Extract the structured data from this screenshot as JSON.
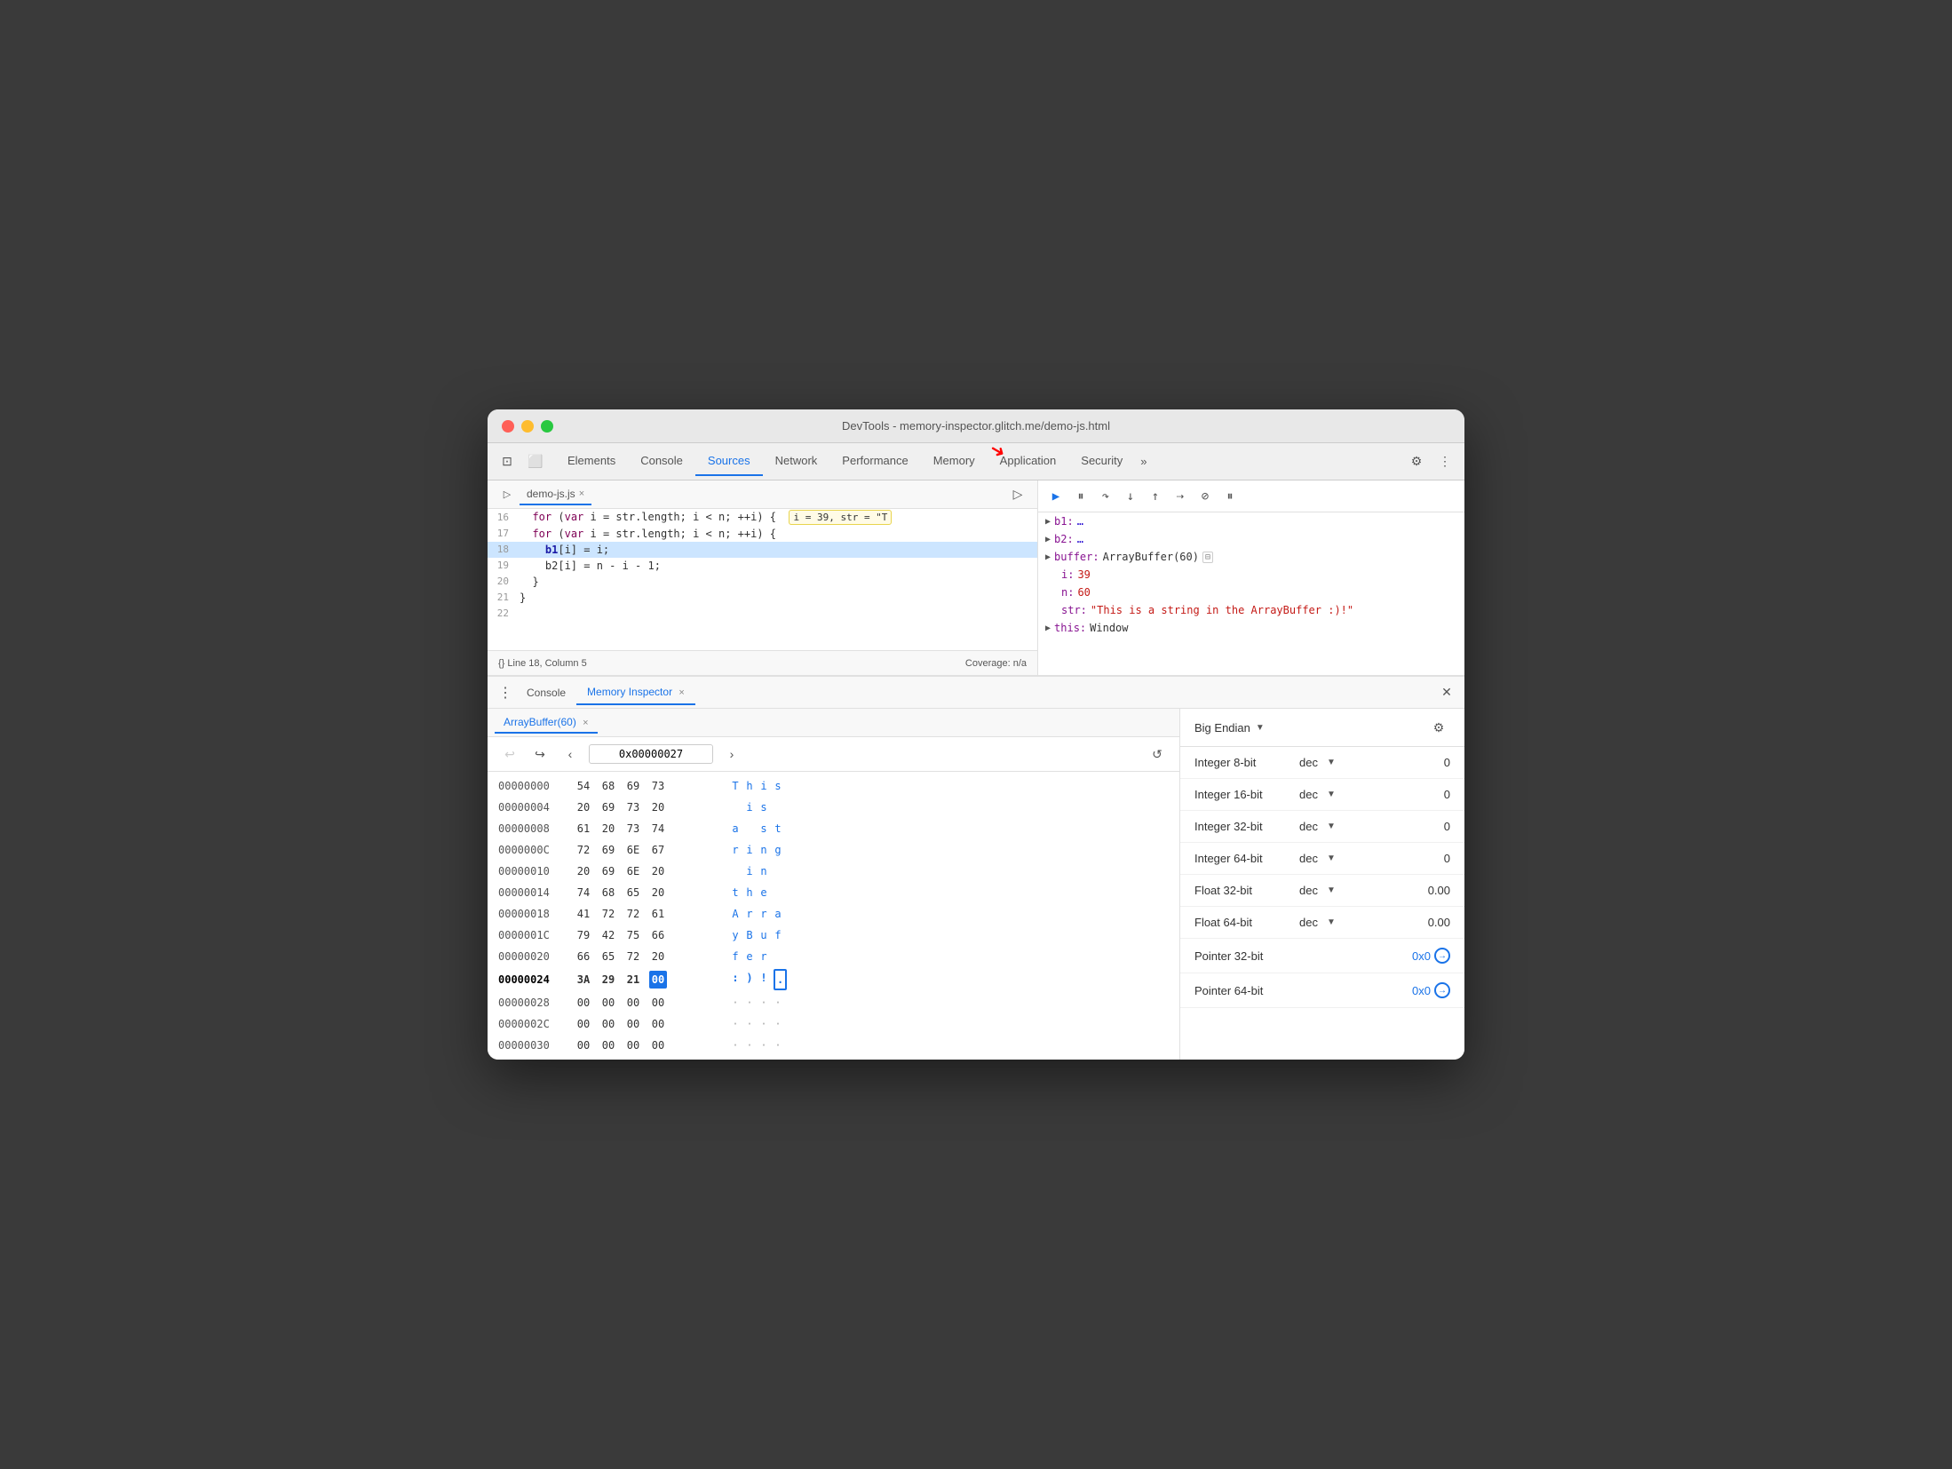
{
  "window": {
    "title": "DevTools - memory-inspector.glitch.me/demo-js.html"
  },
  "traffic_lights": {
    "red": "close",
    "yellow": "minimize",
    "green": "maximize"
  },
  "devtools_tabs": {
    "items": [
      {
        "id": "elements",
        "label": "Elements",
        "active": false
      },
      {
        "id": "console",
        "label": "Console",
        "active": false
      },
      {
        "id": "sources",
        "label": "Sources",
        "active": true
      },
      {
        "id": "network",
        "label": "Network",
        "active": false
      },
      {
        "id": "performance",
        "label": "Performance",
        "active": false
      },
      {
        "id": "memory",
        "label": "Memory",
        "active": false
      },
      {
        "id": "application",
        "label": "Application",
        "active": false
      },
      {
        "id": "security",
        "label": "Security",
        "active": false
      }
    ],
    "more_label": "»"
  },
  "file_tab": {
    "name": "demo-js.js",
    "close": "×"
  },
  "code": {
    "lines": [
      {
        "num": "16",
        "content": "  for (var i = str.length; i < n; ++i) {",
        "extra": "  i = 39, str = \"T",
        "highlighted": false
      },
      {
        "num": "17",
        "content": "  for (var i = str.length; i < n; ++i) {",
        "highlighted": false
      },
      {
        "num": "18",
        "content": "    b1[i] = i;",
        "highlighted": true
      },
      {
        "num": "19",
        "content": "    b2[i] = n - i - 1;",
        "highlighted": false
      },
      {
        "num": "20",
        "content": "  }",
        "highlighted": false
      },
      {
        "num": "21",
        "content": "}",
        "highlighted": false
      },
      {
        "num": "22",
        "content": "",
        "highlighted": false
      }
    ],
    "footer": {
      "left": "{}  Line 18, Column 5",
      "right": "Coverage: n/a"
    }
  },
  "scope": {
    "items": [
      {
        "key": "b1:",
        "val": "…"
      },
      {
        "key": "b2:",
        "val": "…"
      },
      {
        "key": "buffer:",
        "val": "ArrayBuffer(60)",
        "has_icon": true
      },
      {
        "key": "i:",
        "val": "39",
        "color": "red"
      },
      {
        "key": "n:",
        "val": "60",
        "color": "red"
      },
      {
        "key": "str:",
        "val": "\"This is a string in the ArrayBuffer :)!\"",
        "color": "str"
      },
      {
        "key": "this:",
        "val": "Window",
        "color": "black"
      }
    ]
  },
  "bottom_panel": {
    "tabs": [
      {
        "id": "console",
        "label": "Console",
        "active": false
      },
      {
        "id": "memory_inspector",
        "label": "Memory Inspector",
        "active": true,
        "closeable": true
      }
    ],
    "close_btn": "×"
  },
  "memory_inspector": {
    "buffer_tab": "ArrayBuffer(60)",
    "buffer_close": "×",
    "address": "0x00000027",
    "endian": "Big Endian",
    "hex_rows": [
      {
        "addr": "00000000",
        "bytes": [
          "54",
          "68",
          "69",
          "73"
        ],
        "ascii": [
          "T",
          "h",
          "i",
          "s"
        ],
        "active": false
      },
      {
        "addr": "00000004",
        "bytes": [
          "20",
          "69",
          "73",
          "20"
        ],
        "ascii": [
          " ",
          "i",
          "s",
          " "
        ],
        "active": false
      },
      {
        "addr": "00000008",
        "bytes": [
          "61",
          "20",
          "73",
          "74"
        ],
        "ascii": [
          "a",
          " ",
          "s",
          "t"
        ],
        "active": false
      },
      {
        "addr": "0000000C",
        "bytes": [
          "72",
          "69",
          "6E",
          "67"
        ],
        "ascii": [
          "r",
          "i",
          "n",
          "g"
        ],
        "active": false
      },
      {
        "addr": "00000010",
        "bytes": [
          "20",
          "69",
          "6E",
          "20"
        ],
        "ascii": [
          " ",
          "i",
          "n",
          " "
        ],
        "active": false
      },
      {
        "addr": "00000014",
        "bytes": [
          "74",
          "68",
          "65",
          "20"
        ],
        "ascii": [
          "t",
          "h",
          "e",
          " "
        ],
        "active": false
      },
      {
        "addr": "00000018",
        "bytes": [
          "41",
          "72",
          "72",
          "61"
        ],
        "ascii": [
          "A",
          "r",
          "r",
          "a"
        ],
        "active": false
      },
      {
        "addr": "0000001C",
        "bytes": [
          "79",
          "42",
          "75",
          "66"
        ],
        "ascii": [
          "y",
          "B",
          "u",
          "f"
        ],
        "active": false
      },
      {
        "addr": "00000020",
        "bytes": [
          "66",
          "65",
          "72",
          "20"
        ],
        "ascii": [
          "f",
          "e",
          "r",
          " "
        ],
        "active": false
      },
      {
        "addr": "00000024",
        "bytes": [
          "3A",
          "29",
          "21",
          "00"
        ],
        "ascii": [
          ":",
          ")",
          " ",
          "·"
        ],
        "active": true,
        "selected_byte": 3
      },
      {
        "addr": "00000028",
        "bytes": [
          "00",
          "00",
          "00",
          "00"
        ],
        "ascii": [
          "·",
          "·",
          "·",
          "·"
        ],
        "active": false
      },
      {
        "addr": "0000002C",
        "bytes": [
          "00",
          "00",
          "00",
          "00"
        ],
        "ascii": [
          "·",
          "·",
          "·",
          "·"
        ],
        "active": false
      },
      {
        "addr": "00000030",
        "bytes": [
          "00",
          "00",
          "00",
          "00"
        ],
        "ascii": [
          "·",
          "·",
          "·",
          "·"
        ],
        "active": false
      }
    ],
    "value_interpreter": {
      "endian_label": "Big Endian",
      "rows": [
        {
          "label": "Integer 8-bit",
          "type": "dec",
          "value": "0"
        },
        {
          "label": "Integer 16-bit",
          "type": "dec",
          "value": "0"
        },
        {
          "label": "Integer 32-bit",
          "type": "dec",
          "value": "0"
        },
        {
          "label": "Integer 64-bit",
          "type": "dec",
          "value": "0"
        },
        {
          "label": "Float 32-bit",
          "type": "dec",
          "value": "0.00"
        },
        {
          "label": "Float 64-bit",
          "type": "dec",
          "value": "0.00"
        },
        {
          "label": "Pointer 32-bit",
          "type": "",
          "value": "0x0"
        },
        {
          "label": "Pointer 64-bit",
          "type": "",
          "value": "0x0"
        }
      ]
    }
  }
}
